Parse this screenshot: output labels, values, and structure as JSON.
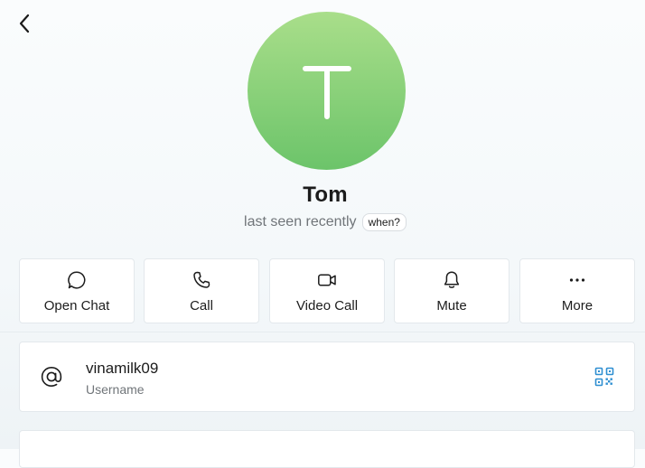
{
  "header": {
    "back_icon": "chevron-left-icon"
  },
  "profile": {
    "initial": "T",
    "name": "Tom",
    "status": "last seen recently",
    "when_badge": "when?",
    "avatar_colors": [
      "#a9de8a",
      "#6cc46a"
    ]
  },
  "actions": [
    {
      "icon": "chat-bubble-icon",
      "label": "Open Chat"
    },
    {
      "icon": "phone-icon",
      "label": "Call"
    },
    {
      "icon": "video-camera-icon",
      "label": "Video Call"
    },
    {
      "icon": "bell-icon",
      "label": "Mute"
    },
    {
      "icon": "more-dots-icon",
      "label": "More"
    }
  ],
  "info": {
    "username": "vinamilk09",
    "username_label": "Username",
    "at_icon": "at-sign-icon",
    "qr_icon": "qr-code-icon",
    "accent_color": "#2f8fd1"
  }
}
